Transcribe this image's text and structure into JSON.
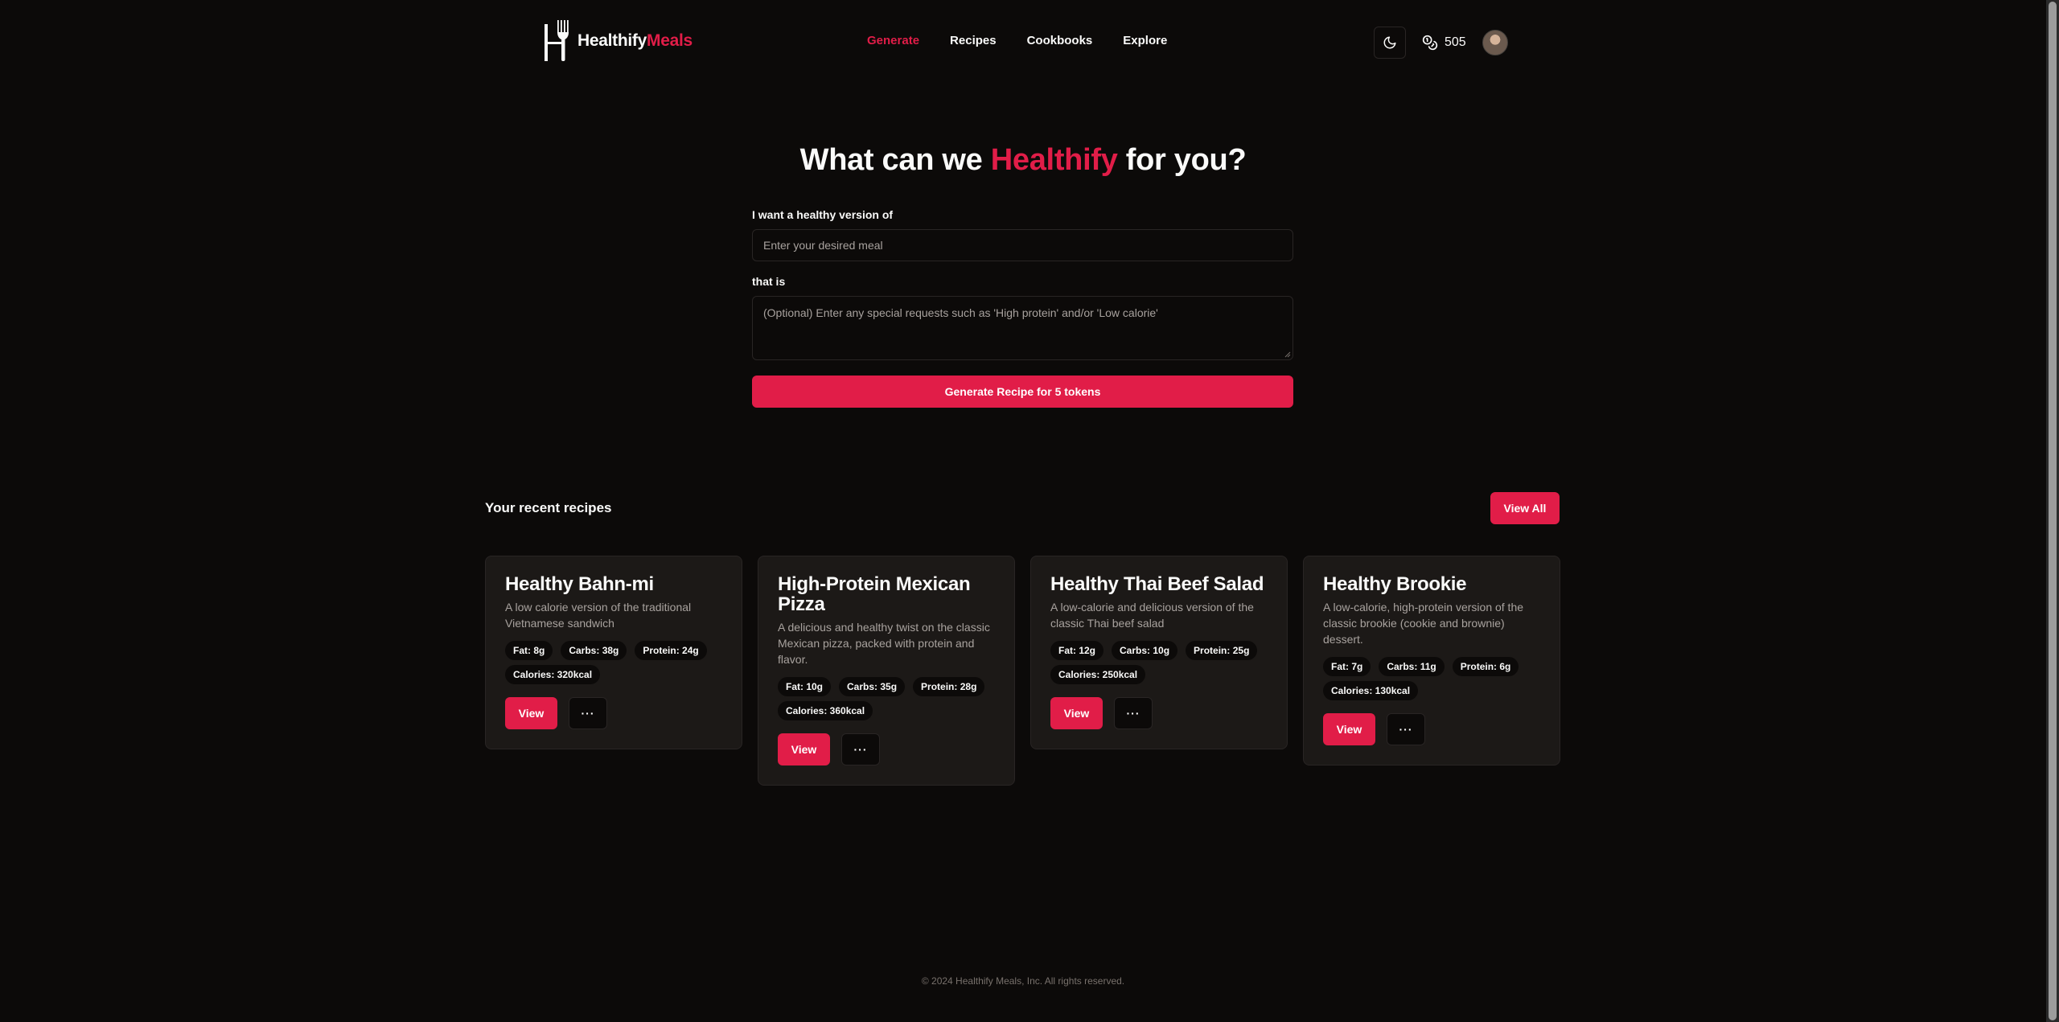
{
  "header": {
    "logo": {
      "brand": "Healthify",
      "accent": "Meals"
    },
    "nav": [
      {
        "label": "Generate",
        "active": true
      },
      {
        "label": "Recipes",
        "active": false
      },
      {
        "label": "Cookbooks",
        "active": false
      },
      {
        "label": "Explore",
        "active": false
      }
    ],
    "tokens": "505",
    "theme_icon": "moon-icon",
    "token_icon": "coins-icon"
  },
  "hero": {
    "title_before": "What can we ",
    "title_accent": "Healthify",
    "title_after": " for you?"
  },
  "form": {
    "meal_label": "I want a healthy version of",
    "meal_placeholder": "Enter your desired meal",
    "requests_label": "that is",
    "requests_placeholder": "(Optional) Enter any special requests such as 'High protein' and/or 'Low calorie'",
    "generate_label": "Generate Recipe for 5 tokens"
  },
  "recent": {
    "title": "Your recent recipes",
    "view_all_label": "View All",
    "recipes": [
      {
        "title": "Healthy Bahn-mi",
        "description": "A low calorie version of the traditional Vietnamese sandwich",
        "fat": "Fat: 8g",
        "carbs": "Carbs: 38g",
        "protein": "Protein: 24g",
        "calories": "Calories: 320kcal",
        "view_label": "View",
        "more_label": "···"
      },
      {
        "title": "High-Protein Mexican Pizza",
        "description": "A delicious and healthy twist on the classic Mexican pizza, packed with protein and flavor.",
        "fat": "Fat: 10g",
        "carbs": "Carbs: 35g",
        "protein": "Protein: 28g",
        "calories": "Calories: 360kcal",
        "view_label": "View",
        "more_label": "···"
      },
      {
        "title": "Healthy Thai Beef Salad",
        "description": "A low-calorie and delicious version of the classic Thai beef salad",
        "fat": "Fat: 12g",
        "carbs": "Carbs: 10g",
        "protein": "Protein: 25g",
        "calories": "Calories: 250kcal",
        "view_label": "View",
        "more_label": "···"
      },
      {
        "title": "Healthy Brookie",
        "description": "A low-calorie, high-protein version of the classic brookie (cookie and brownie) dessert.",
        "fat": "Fat: 7g",
        "carbs": "Carbs: 11g",
        "protein": "Protein: 6g",
        "calories": "Calories: 130kcal",
        "view_label": "View",
        "more_label": "···"
      }
    ]
  },
  "footer": {
    "text": "© 2024 Healthify Meals, Inc. All rights reserved."
  },
  "colors": {
    "accent": "#e11d48",
    "background": "#0c0a09",
    "card": "#1c1917",
    "muted": "#a8a29e"
  }
}
